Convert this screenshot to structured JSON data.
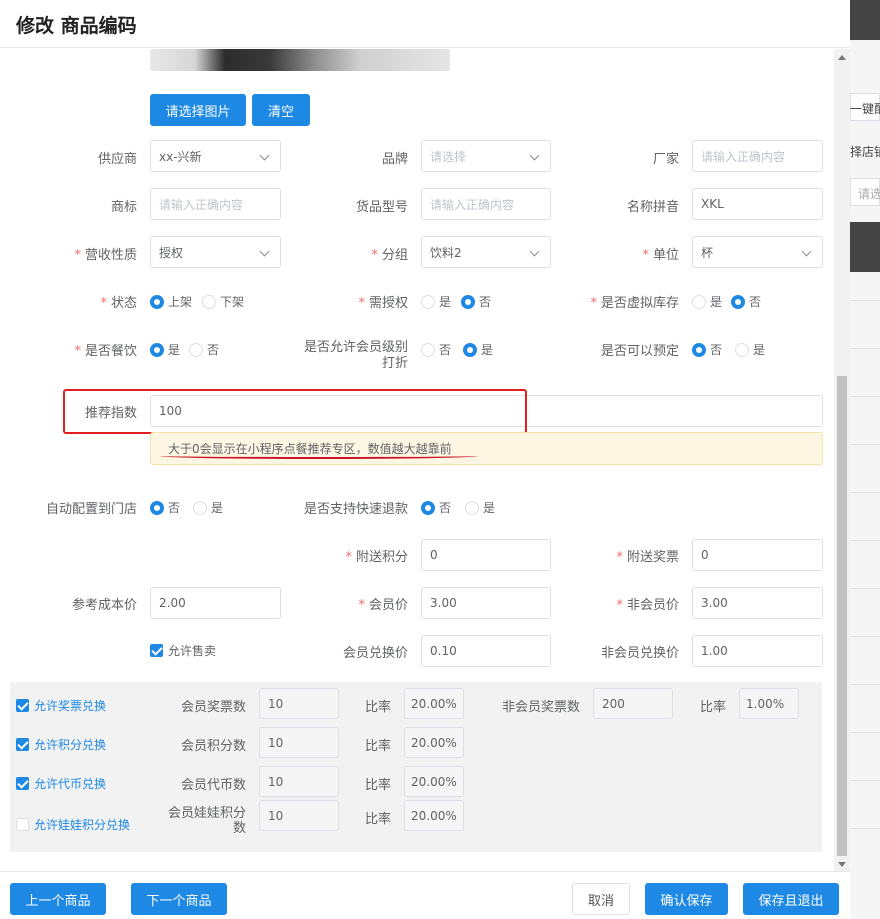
{
  "dialog": {
    "title": "修改 商品编码"
  },
  "image_buttons": {
    "select": "请选择图片",
    "clear": "清空"
  },
  "row1": {
    "supplier": {
      "label": "供应商",
      "value": "xx-兴新"
    },
    "brand": {
      "label": "品牌",
      "placeholder": "请选择"
    },
    "manufacturer": {
      "label": "厂家",
      "placeholder": "请输入正确内容"
    }
  },
  "row2": {
    "trademark": {
      "label": "商标",
      "placeholder": "请输入正确内容"
    },
    "model": {
      "label": "货品型号",
      "placeholder": "请输入正确内容"
    },
    "pinyin": {
      "label": "名称拼音",
      "value": "XKL"
    }
  },
  "row3": {
    "revenue_type": {
      "label": "营收性质",
      "value": "授权"
    },
    "group": {
      "label": "分组",
      "value": "饮料2"
    },
    "unit": {
      "label": "单位",
      "value": "杯"
    }
  },
  "row4": {
    "status": {
      "label": "状态",
      "options": [
        "上架",
        "下架"
      ]
    },
    "need_auth": {
      "label": "需授权",
      "options": [
        "是",
        "否"
      ]
    },
    "virtual_stock": {
      "label": "是否虚拟库存",
      "options": [
        "是",
        "否"
      ]
    }
  },
  "row5": {
    "is_food": {
      "label": "是否餐饮",
      "options": [
        "是",
        "否"
      ]
    },
    "member_discount": {
      "label_line1": "是否允许会员级别",
      "label_line2": "打折",
      "options": [
        "否",
        "是"
      ]
    },
    "reservable": {
      "label": "是否可以预定",
      "options": [
        "否",
        "是"
      ]
    }
  },
  "recommend": {
    "label": "推荐指数",
    "value": "100",
    "tip": "大于0会显示在小程序点餐推荐专区，数值越大越靠前"
  },
  "row7": {
    "auto_config": {
      "label": "自动配置到门店",
      "options": [
        "否",
        "是"
      ]
    },
    "quick_refund": {
      "label": "是否支持快速退款",
      "options": [
        "否",
        "是"
      ]
    }
  },
  "row8": {
    "bonus_points": {
      "label": "附送积分",
      "value": "0"
    },
    "bonus_tickets": {
      "label": "附送奖票",
      "value": "0"
    }
  },
  "row9": {
    "ref_cost": {
      "label": "参考成本价",
      "value": "2.00"
    },
    "member_price": {
      "label": "会员价",
      "value": "3.00"
    },
    "non_member_price": {
      "label": "非会员价",
      "value": "3.00"
    }
  },
  "row10": {
    "allow_sale": "允许售卖",
    "member_exchange": {
      "label": "会员兑换价",
      "value": "0.10"
    },
    "non_member_exchange": {
      "label": "非会员兑换价",
      "value": "1.00"
    }
  },
  "exchange": {
    "ticket": {
      "check": "允许奖票兑换",
      "member_label": "会员奖票数",
      "member_value": "10",
      "ratio_label": "比率",
      "ratio_value": "20.00%",
      "non_member_label": "非会员奖票数",
      "non_member_value": "200",
      "non_ratio_label": "比率",
      "non_ratio_value": "1.00%"
    },
    "points": {
      "check": "允许积分兑换",
      "member_label": "会员积分数",
      "member_value": "10",
      "ratio_label": "比率",
      "ratio_value": "20.00%"
    },
    "coins": {
      "check": "允许代币兑换",
      "member_label": "会员代币数",
      "member_value": "10",
      "ratio_label": "比率",
      "ratio_value": "20.00%"
    },
    "doll": {
      "check": "允许娃娃积分兑换",
      "member_label_line1": "会员娃娃积分",
      "member_label_line2": "数",
      "member_value": "10",
      "ratio_label": "比率",
      "ratio_value": "20.00%"
    }
  },
  "footer": {
    "prev": "上一个商品",
    "next": "下一个商品",
    "cancel": "取消",
    "confirm": "确认保存",
    "save_exit": "保存且退出"
  },
  "background": {
    "snippet1": "一键配",
    "snippet2": "择店铺",
    "snippet3": "请选"
  },
  "colors": {
    "primary": "#1e88e5",
    "required": "#f56c6c",
    "highlight": "#e02020",
    "tip_bg": "#fdf6e3"
  }
}
